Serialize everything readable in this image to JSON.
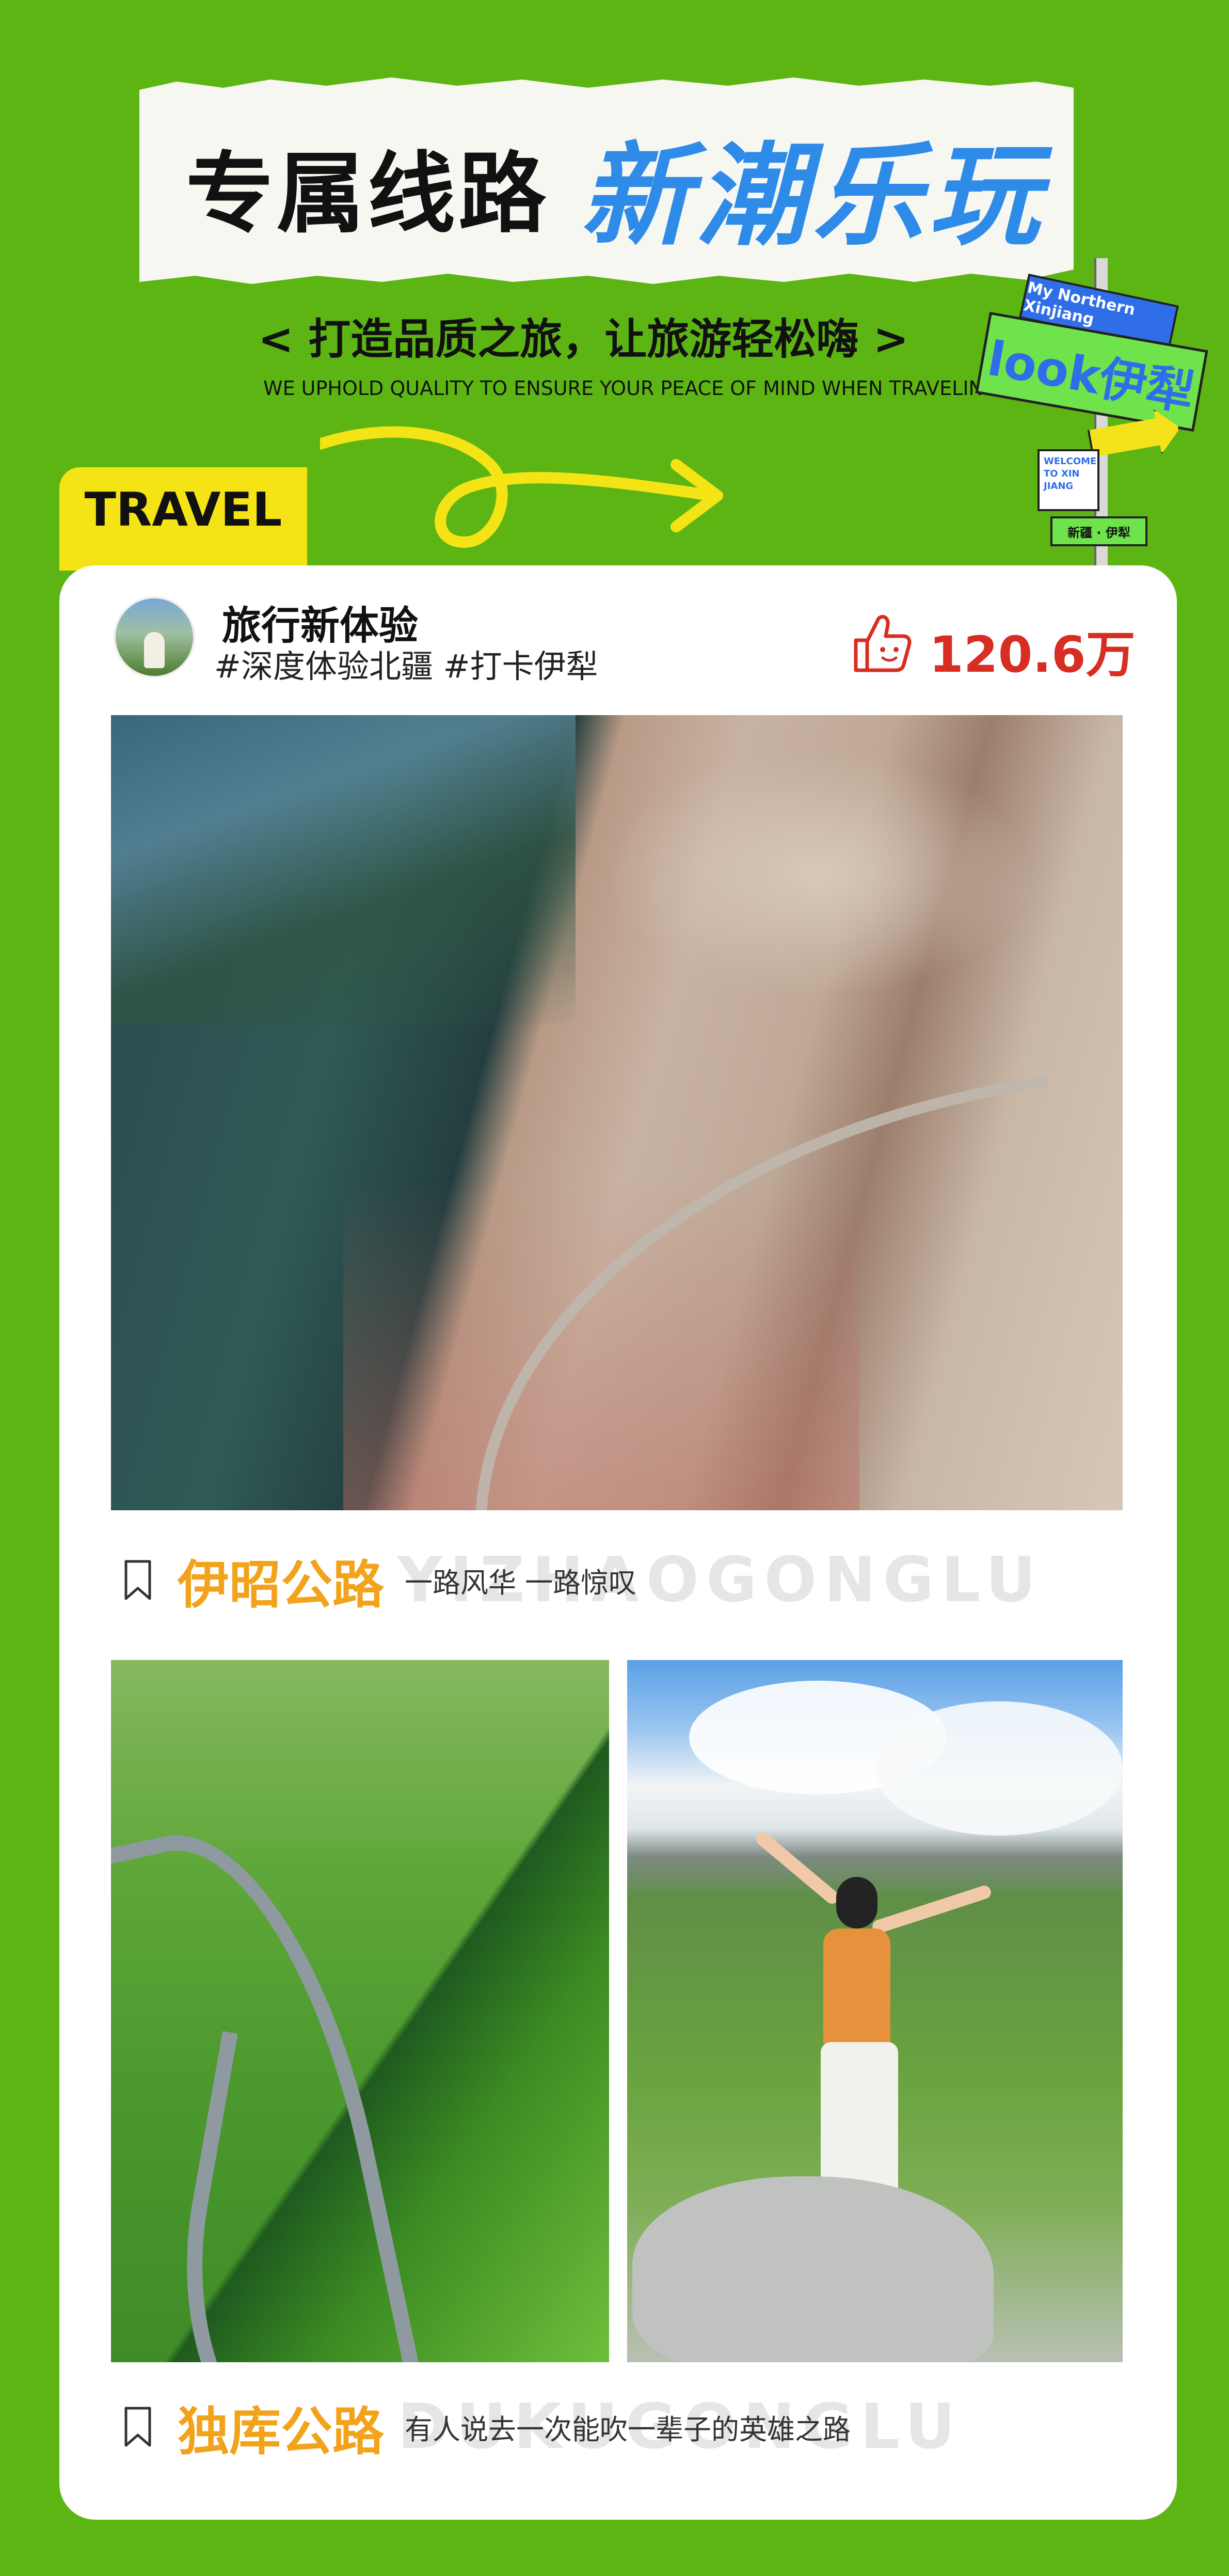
{
  "header": {
    "title_black": "专属线路",
    "title_blue": "新潮乐玩",
    "subtitle": "< 打造品质之旅，让旅游轻松嗨 >",
    "subtitle_en": "WE UPHOLD QUALITY TO ENSURE YOUR PEACE OF MIND WHEN TRAVELING"
  },
  "sign": {
    "blue": "My Northern Xinjiang",
    "green": "look伊犁",
    "white": "WELCOME TO XIN JIANG",
    "small": "新疆 · 伊犁"
  },
  "tab": {
    "label": "TRAVEL"
  },
  "post": {
    "author": "旅行新体验",
    "tags": "#深度体验北疆 #打卡伊犁",
    "likes": "120.6万"
  },
  "routes": [
    {
      "title": "伊昭公路",
      "watermark": "YIZHAOGONGLU",
      "desc": "一路风华 一路惊叹"
    },
    {
      "title": "独库公路",
      "watermark": "DUKUGONGLU",
      "desc": "有人说去一次能吹一辈子的英雄之路"
    }
  ],
  "colors": {
    "background": "#5db514",
    "accent_blue": "#2f8be8",
    "tab_yellow": "#f5e415",
    "likes_red": "#d82d22",
    "route_orange": "#f2a21b"
  }
}
